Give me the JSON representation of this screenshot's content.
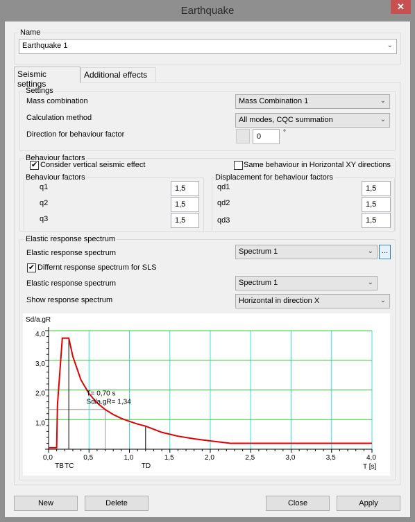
{
  "window": {
    "title": "Earthquake",
    "close_icon": "close-icon"
  },
  "name": {
    "label": "Name",
    "value": "Earthquake 1"
  },
  "tabs": [
    {
      "label": "Seismic settings",
      "active": true
    },
    {
      "label": "Additional effects",
      "active": false
    }
  ],
  "settings": {
    "title": "Settings",
    "mass_combination": {
      "label": "Mass combination",
      "value": "Mass Combination 1"
    },
    "calculation_method": {
      "label": "Calculation method",
      "value": "All modes, CQC summation"
    },
    "direction": {
      "label": "Direction for behaviour factor",
      "value": "0",
      "unit": "°"
    }
  },
  "behaviour": {
    "title": "Behaviour factors",
    "consider_vertical": {
      "label": "Consider vertical seismic effect",
      "checked": true
    },
    "same_xy": {
      "label": "Same behaviour in Horizontal XY directions",
      "checked": false
    },
    "factors": {
      "title": "Behaviour factors",
      "items": [
        {
          "label": "q1",
          "value": "1,5"
        },
        {
          "label": "q2",
          "value": "1,5"
        },
        {
          "label": "q3",
          "value": "1,5"
        }
      ]
    },
    "displacement": {
      "title": "Displacement for behaviour factors",
      "items": [
        {
          "label": "qd1",
          "value": "1,5"
        },
        {
          "label": "qd2",
          "value": "1,5"
        },
        {
          "label": "qd3",
          "value": "1,5"
        }
      ]
    }
  },
  "spectrum": {
    "title": "Elastic response spectrum",
    "elastic": {
      "label": "Elastic response spectrum",
      "value": "Spectrum 1",
      "more": "..."
    },
    "different_sls": {
      "label": "Differnt response spectrum for SLS",
      "checked": true
    },
    "elastic_sls": {
      "label": "Elastic response spectrum",
      "value": "Spectrum 1"
    },
    "show": {
      "label": "Show response spectrum",
      "value": "Horizontal in direction X"
    }
  },
  "chart_data": {
    "type": "line",
    "xlabel": "T [s]",
    "ylabel": "Sd/a.gR",
    "xlim": [
      0,
      4
    ],
    "ylim": [
      0,
      4
    ],
    "xticks": [
      "0,0",
      "0,5",
      "1,0",
      "1,5",
      "2,0",
      "2,5",
      "3,0",
      "3,5",
      "4,0"
    ],
    "yticks": [
      "1,0",
      "2,0",
      "3,0",
      "4,0"
    ],
    "grid": true,
    "grid_colors": {
      "vertical": "#33e0e0",
      "horizontal": "#33cc33"
    },
    "line_color": "#e00000",
    "series": [
      {
        "x": [
          0,
          0.1,
          0.11,
          0.15,
          0.17,
          0.25,
          0.3,
          0.4,
          0.5,
          0.6,
          0.7,
          0.8,
          0.9,
          1.0,
          1.1,
          1.2,
          1.4,
          1.6,
          1.8,
          2.0,
          2.25,
          4.0
        ],
        "y": [
          0.05,
          0.05,
          1.5,
          3.0,
          3.75,
          3.75,
          3.13,
          2.34,
          1.88,
          1.56,
          1.34,
          1.17,
          1.04,
          0.94,
          0.85,
          0.78,
          0.57,
          0.44,
          0.35,
          0.28,
          0.2,
          0.2
        ]
      }
    ],
    "markers": [
      {
        "label": "TB",
        "x": 0.13
      },
      {
        "label": "TC",
        "x": 0.25,
        "y": 3.75
      },
      {
        "label": "TD",
        "x": 1.2,
        "y": 0.78
      }
    ],
    "annotation": {
      "x": 0.7,
      "y": 1.34,
      "lines": [
        "T= 0,70 s",
        "Sd/a.gR= 1,34"
      ]
    }
  },
  "buttons": {
    "new": "New",
    "delete": "Delete",
    "close": "Close",
    "apply": "Apply"
  }
}
